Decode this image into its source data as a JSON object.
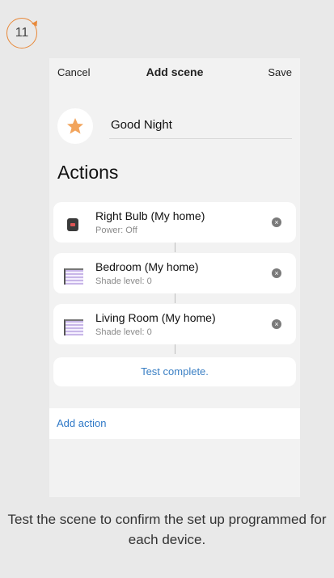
{
  "step": {
    "number": "11"
  },
  "nav": {
    "cancel": "Cancel",
    "title": "Add scene",
    "save": "Save"
  },
  "scene": {
    "name": "Good Night",
    "icon": "star-icon"
  },
  "actions": {
    "heading": "Actions",
    "items": [
      {
        "name": "Right Bulb (My home)",
        "detail": "Power: Off",
        "icon": "smart-plug-icon"
      },
      {
        "name": "Bedroom (My home)",
        "detail": "Shade level: 0",
        "icon": "window-shade-icon"
      },
      {
        "name": "Living Room (My home)",
        "detail": "Shade level: 0",
        "icon": "window-shade-icon"
      }
    ],
    "test_status": "Test complete.",
    "add_action": "Add action"
  },
  "caption": "Test the scene to confirm the set up programmed for each device.",
  "colors": {
    "accent": "#e8893a",
    "link": "#2e78c7",
    "star": "#f2a45c"
  }
}
